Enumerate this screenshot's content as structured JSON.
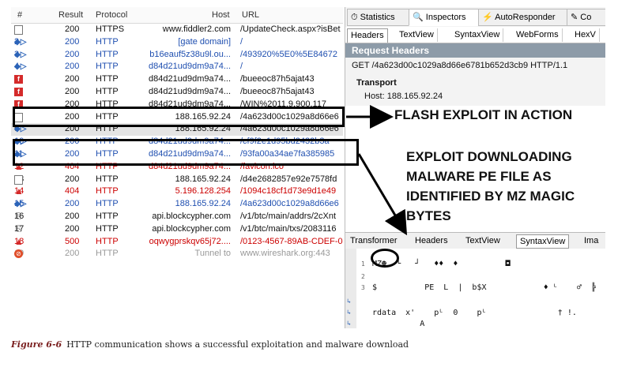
{
  "grid": {
    "headers": {
      "num": "#",
      "result": "Result",
      "protocol": "Protocol",
      "host": "Host",
      "url": "URL"
    },
    "rows": [
      {
        "num": "1",
        "icon": "page-icon",
        "result": "200",
        "protocol": "HTTPS",
        "host": "www.fiddler2.com",
        "url": "/UpdateCheck.aspx?isBet",
        "color": "black"
      },
      {
        "num": "2",
        "icon": "arrows-icon",
        "result": "200",
        "protocol": "HTTP",
        "host": "[gate domain]",
        "url": "/",
        "color": "blue"
      },
      {
        "num": "3",
        "icon": "arrows-icon",
        "result": "200",
        "protocol": "HTTP",
        "host": "b16eauf5z38u9l.ou...",
        "url": "/493920%5E0%5E84672",
        "color": "blue"
      },
      {
        "num": "4",
        "icon": "arrows-icon",
        "result": "200",
        "protocol": "HTTP",
        "host": "d84d21ud9dm9a74...",
        "url": "/",
        "color": "blue"
      },
      {
        "num": "5",
        "icon": "flash-icon",
        "result": "200",
        "protocol": "HTTP",
        "host": "d84d21ud9dm9a74...",
        "url": "/bueeoc87h5ajat43",
        "color": "black"
      },
      {
        "num": "6",
        "icon": "flash-icon",
        "result": "200",
        "protocol": "HTTP",
        "host": "d84d21ud9dm9a74...",
        "url": "/bueeoc87h5ajat43",
        "color": "black"
      },
      {
        "num": "7",
        "icon": "flash-icon",
        "result": "200",
        "protocol": "HTTP",
        "host": "d84d21ud9dm9a74...",
        "url": "/WIN%2011,9,900,117",
        "color": "black"
      },
      {
        "num": "8",
        "icon": "page-icon",
        "result": "200",
        "protocol": "HTTP",
        "host": "188.165.92.24",
        "url": "/4a623d00c1029a8d66e6",
        "color": "black"
      },
      {
        "num": "9",
        "icon": "arrows-icon",
        "result": "200",
        "protocol": "HTTP",
        "host": "188.165.92.24",
        "url": "/4a623d00c1029a8d66e6",
        "color": "black",
        "selected": true
      },
      {
        "num": "10",
        "icon": "arrows-icon",
        "result": "200",
        "protocol": "HTTP",
        "host": "d84d21ud9dm9a74...",
        "url": "/cf9f2e1d95bd2432b3a",
        "color": "blue"
      },
      {
        "num": "11",
        "icon": "arrows-icon",
        "result": "200",
        "protocol": "HTTP",
        "host": "d84d21ud9dm9a74...",
        "url": "/93fa00a34ae7fa385985",
        "color": "blue"
      },
      {
        "num": "12",
        "icon": "warn-icon",
        "result": "404",
        "protocol": "HTTP",
        "host": "d84d21ud9dm9a74...",
        "url": "/favicon.ico",
        "color": "red"
      },
      {
        "num": "13",
        "icon": "page-icon",
        "result": "200",
        "protocol": "HTTP",
        "host": "188.165.92.24",
        "url": "/d4e2682857e92e7578fd",
        "color": "black"
      },
      {
        "num": "14",
        "icon": "warn-icon",
        "result": "404",
        "protocol": "HTTP",
        "host": "5.196.128.254",
        "url": "/1094c18cf1d73e9d1e49",
        "color": "red"
      },
      {
        "num": "15",
        "icon": "arrows-icon",
        "result": "200",
        "protocol": "HTTP",
        "host": "188.165.92.24",
        "url": "/4a623d00c1029a8d66e6",
        "color": "blue"
      },
      {
        "num": "16",
        "icon": "lock-icon",
        "result": "200",
        "protocol": "HTTP",
        "host": "api.blockcypher.com",
        "url": "/v1/btc/main/addrs/2cXnt",
        "color": "black"
      },
      {
        "num": "17",
        "icon": "lock-icon",
        "result": "200",
        "protocol": "HTTP",
        "host": "api.blockcypher.com",
        "url": "/v1/btc/main/txs/2083116",
        "color": "black"
      },
      {
        "num": "18",
        "icon": "warn-icon",
        "result": "500",
        "protocol": "HTTP",
        "host": "oqwygprskqv65j72....",
        "url": "/0123-4567-89AB-CDEF-0",
        "color": "red"
      },
      {
        "num": "19",
        "icon": "block-icon",
        "result": "200",
        "protocol": "HTTP",
        "host": "Tunnel to",
        "url": "www.wireshark.org:443",
        "color": "grey"
      }
    ]
  },
  "inspectors": {
    "top_tabs": [
      "Statistics",
      "Inspectors",
      "AutoResponder",
      "Co"
    ],
    "sub_tabs": [
      "Headers",
      "TextView",
      "SyntaxView",
      "WebForms",
      "HexV"
    ],
    "request_headers_title": "Request Headers",
    "request_line": "GET /4a623d00c1029a8d66e6781b652d3cb9 HTTP/1.1",
    "transport_label": "Transport",
    "host_line": "Host: 188.165.92.24",
    "response_tabs": [
      "Transformer",
      "Headers",
      "TextView",
      "SyntaxView",
      "Ima"
    ],
    "hex_lines": [
      {
        "num": "1",
        "text": "MZ☻  └   ┘   ♦♦  ♦          ◘"
      },
      {
        "num": "2",
        "text": ""
      },
      {
        "num": "3",
        "text": "$          PE  L  |  b$X            ♦ ᴸ    ♂  ╠"
      },
      {
        "num": "",
        "text": ""
      },
      {
        "num": "",
        "text": "rdata  x'    pᴸ  0    pᴸ               † !."
      },
      {
        "num": "",
        "text": "          A"
      }
    ]
  },
  "annotations": {
    "flash": "FLASH EXPLOIT IN ACTION",
    "download_1": "EXPLOIT DOWNLOADING",
    "download_2": "MALWARE PE FILE AS",
    "download_3": "IDENTIFIED BY MZ MAGIC",
    "download_4": "BYTES"
  },
  "caption": {
    "label": "Figure 6-6",
    "text": "HTTP communication shows a successful exploitation and malware download"
  }
}
